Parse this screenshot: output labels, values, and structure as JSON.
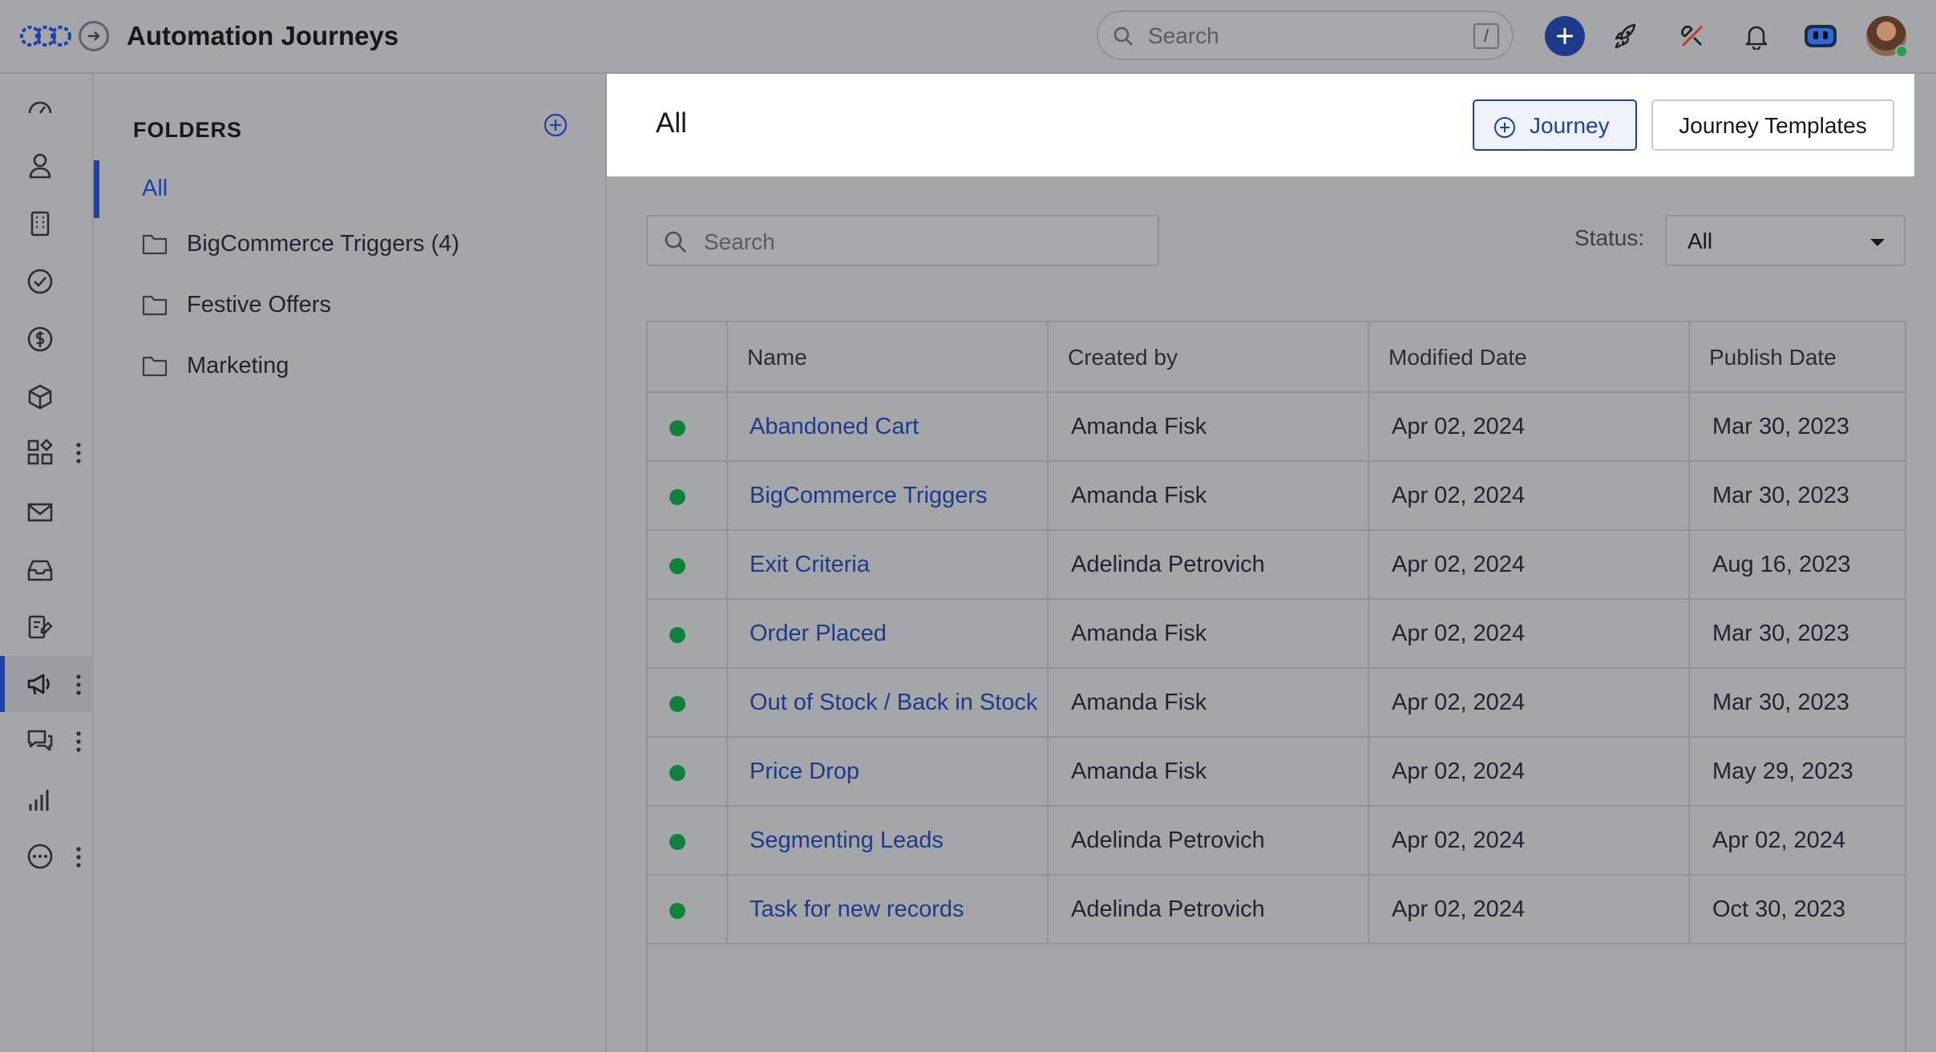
{
  "app": {
    "title": "Automation Journeys"
  },
  "topbar": {
    "search_placeholder": "Search",
    "shortcut_key": "/",
    "icons": [
      "add-icon",
      "rocket-icon",
      "tools-icon",
      "bell-icon",
      "bot-icon"
    ],
    "accent": "#1e3a8a"
  },
  "rail": {
    "items": [
      {
        "name": "dashboard-icon"
      },
      {
        "name": "contacts-icon"
      },
      {
        "name": "accounts-icon"
      },
      {
        "name": "tasks-icon"
      },
      {
        "name": "deals-icon"
      },
      {
        "name": "products-icon"
      },
      {
        "name": "apps-icon",
        "menu": true
      },
      {
        "name": "email-icon"
      },
      {
        "name": "inbox-icon"
      },
      {
        "name": "forms-icon"
      },
      {
        "name": "campaigns-icon",
        "menu": true,
        "active": true
      },
      {
        "name": "conversations-icon",
        "menu": true
      },
      {
        "name": "reports-icon"
      },
      {
        "name": "more-icon",
        "menu": true
      }
    ]
  },
  "folders": {
    "title": "FOLDERS",
    "all_label": "All",
    "items": [
      {
        "label": "BigCommerce Triggers (4)"
      },
      {
        "label": "Festive Offers"
      },
      {
        "label": "Marketing"
      }
    ]
  },
  "main": {
    "title": "All",
    "journey_button": "Journey",
    "templates_button": "Journey Templates",
    "search_placeholder": "Search",
    "status_label": "Status:",
    "status_value": "All"
  },
  "table": {
    "columns": [
      "Name",
      "Created by",
      "Modified Date",
      "Publish Date"
    ],
    "status_color": "#11823b",
    "rows": [
      {
        "name": "Abandoned Cart",
        "created_by": "Amanda Fisk",
        "modified": "Apr 02, 2024",
        "published": "Mar 30, 2023"
      },
      {
        "name": "BigCommerce Triggers",
        "created_by": "Amanda Fisk",
        "modified": "Apr 02, 2024",
        "published": "Mar 30, 2023"
      },
      {
        "name": "Exit Criteria",
        "created_by": "Adelinda Petrovich",
        "modified": "Apr 02, 2024",
        "published": "Aug 16, 2023"
      },
      {
        "name": "Order Placed",
        "created_by": "Amanda Fisk",
        "modified": "Apr 02, 2024",
        "published": "Mar 30, 2023"
      },
      {
        "name": "Out of Stock / Back in Stock",
        "created_by": "Amanda Fisk",
        "modified": "Apr 02, 2024",
        "published": "Mar 30, 2023"
      },
      {
        "name": "Price Drop",
        "created_by": "Amanda Fisk",
        "modified": "Apr 02, 2024",
        "published": "May 29, 2023"
      },
      {
        "name": "Segmenting Leads",
        "created_by": "Adelinda Petrovich",
        "modified": "Apr 02, 2024",
        "published": "Apr 02, 2024"
      },
      {
        "name": "Task for new records",
        "created_by": "Adelinda Petrovich",
        "modified": "Apr 02, 2024",
        "published": "Oct 30, 2023"
      }
    ]
  }
}
